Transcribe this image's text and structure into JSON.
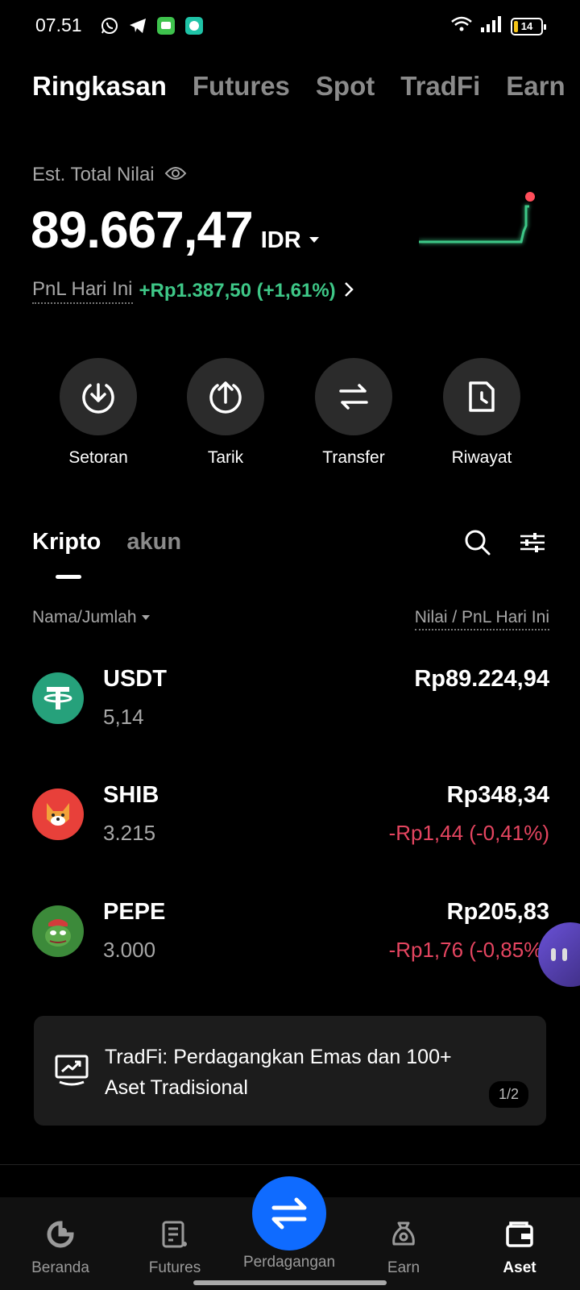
{
  "status_bar": {
    "time": "07.51",
    "battery": "14",
    "app_icons": [
      "whatsapp-icon",
      "telegram-icon",
      "messages-icon",
      "chat-app-icon"
    ]
  },
  "top_tabs": [
    "Ringkasan",
    "Futures",
    "Spot",
    "TradFi",
    "Earn"
  ],
  "summary": {
    "est_label": "Est. Total Nilai",
    "total_value": "89.667,47",
    "currency": "IDR",
    "pnl_label": "PnL Hari Ini",
    "pnl_value": "+Rp1.387,50 (+1,61%)",
    "accent_green": "#3ec787"
  },
  "actions": [
    {
      "label": "Setoran",
      "icon": "deposit-icon"
    },
    {
      "label": "Tarik",
      "icon": "withdraw-icon"
    },
    {
      "label": "Transfer",
      "icon": "transfer-icon"
    },
    {
      "label": "Riwayat",
      "icon": "history-icon"
    }
  ],
  "asset_tabs": {
    "active": "Kripto",
    "inactive": "akun"
  },
  "list_header": {
    "left": "Nama/Jumlah",
    "right": "Nilai / PnL Hari Ini"
  },
  "assets": [
    {
      "symbol": "USDT",
      "amount": "5,14",
      "value": "Rp89.224,94",
      "pnl": "",
      "logo_color": "#26a17b"
    },
    {
      "symbol": "SHIB",
      "amount": "3.215",
      "value": "Rp348,34",
      "pnl": "-Rp1,44 (-0,41%)",
      "logo_color": "#e8403a"
    },
    {
      "symbol": "PEPE",
      "amount": "3.000",
      "value": "Rp205,83",
      "pnl": "-Rp1,76 (-0,85%)",
      "logo_color": "#3c8a3a"
    }
  ],
  "banner": {
    "text": "TradFi: Perdagangkan Emas dan 100+ Aset Tradisional",
    "pager": "1/2"
  },
  "bottom_nav": [
    {
      "label": "Beranda",
      "icon": "home-icon"
    },
    {
      "label": "Futures",
      "icon": "futures-icon"
    },
    {
      "label": "Perdagangan",
      "icon": "trade-swap-icon"
    },
    {
      "label": "Earn",
      "icon": "earn-icon"
    },
    {
      "label": "Aset",
      "icon": "wallet-icon"
    }
  ]
}
